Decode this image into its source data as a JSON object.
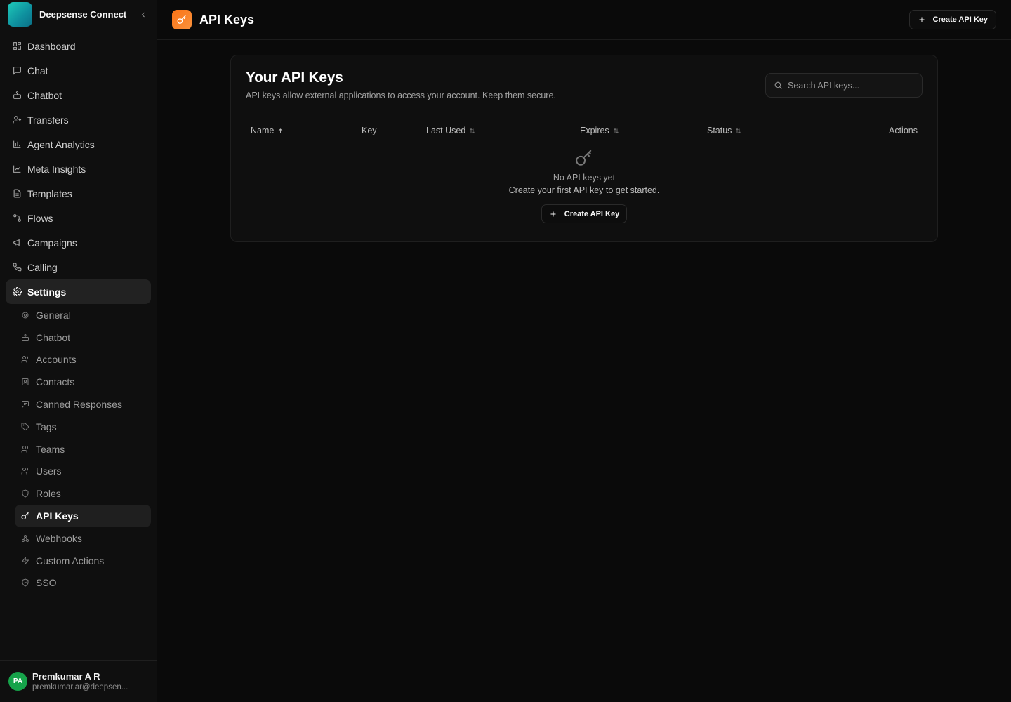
{
  "brand": {
    "name": "Deepsense Connect"
  },
  "nav": [
    {
      "label": "Dashboard",
      "icon": "dashboard-icon"
    },
    {
      "label": "Chat",
      "icon": "chat-icon"
    },
    {
      "label": "Chatbot",
      "icon": "bot-icon"
    },
    {
      "label": "Transfers",
      "icon": "transfer-icon"
    },
    {
      "label": "Agent Analytics",
      "icon": "bar-chart-icon"
    },
    {
      "label": "Meta Insights",
      "icon": "line-chart-icon"
    },
    {
      "label": "Templates",
      "icon": "file-icon"
    },
    {
      "label": "Flows",
      "icon": "flow-icon"
    },
    {
      "label": "Campaigns",
      "icon": "megaphone-icon"
    },
    {
      "label": "Calling",
      "icon": "phone-icon"
    },
    {
      "label": "Settings",
      "icon": "gear-icon",
      "active": true
    }
  ],
  "settings_sub": [
    {
      "label": "General",
      "icon": "gear-icon"
    },
    {
      "label": "Chatbot",
      "icon": "bot-icon"
    },
    {
      "label": "Accounts",
      "icon": "users-icon"
    },
    {
      "label": "Contacts",
      "icon": "contact-icon"
    },
    {
      "label": "Canned Responses",
      "icon": "message-icon"
    },
    {
      "label": "Tags",
      "icon": "tag-icon"
    },
    {
      "label": "Teams",
      "icon": "users-icon"
    },
    {
      "label": "Users",
      "icon": "users-icon"
    },
    {
      "label": "Roles",
      "icon": "shield-icon"
    },
    {
      "label": "API Keys",
      "icon": "key-icon",
      "active": true
    },
    {
      "label": "Webhooks",
      "icon": "webhook-icon"
    },
    {
      "label": "Custom Actions",
      "icon": "bolt-icon"
    },
    {
      "label": "SSO",
      "icon": "shield-check-icon"
    }
  ],
  "user": {
    "initials": "PA",
    "name": "Premkumar A R",
    "email": "premkumar.ar@deepsen..."
  },
  "header": {
    "title": "API Keys",
    "create_label": "Create API Key"
  },
  "card": {
    "title": "Your API Keys",
    "description": "API keys allow external applications to access your account. Keep them secure.",
    "search_placeholder": "Search API keys..."
  },
  "table": {
    "columns": [
      {
        "label": "Name",
        "sort": "asc"
      },
      {
        "label": "Key",
        "sort": "none"
      },
      {
        "label": "Last Used",
        "sort": "both"
      },
      {
        "label": "Expires",
        "sort": "both"
      },
      {
        "label": "Status",
        "sort": "both"
      },
      {
        "label": "Actions",
        "sort": "none"
      }
    ],
    "empty_title": "No API keys yet",
    "empty_subtitle": "Create your first API key to get started.",
    "empty_button": "Create API Key"
  },
  "colors": {
    "accent": "#f97316",
    "avatar": "#16a34a",
    "brand": "#1ec9b8"
  }
}
